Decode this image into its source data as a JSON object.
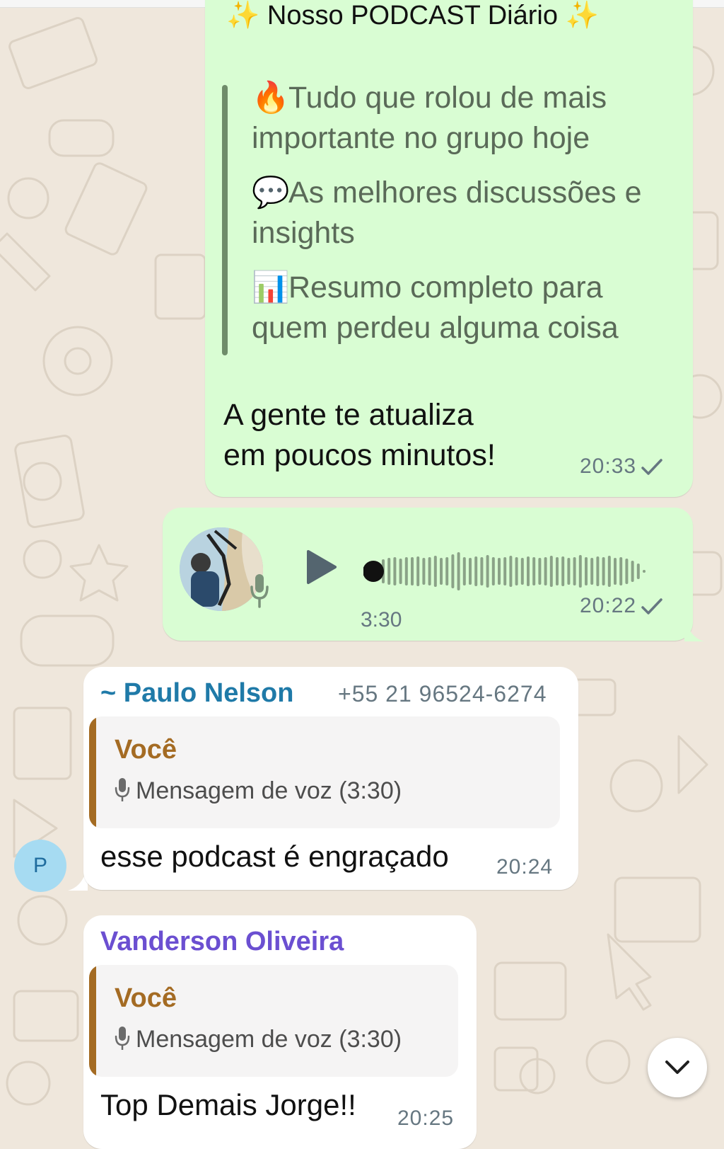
{
  "messages": {
    "podcast": {
      "title_emoji_left": "✨",
      "title": "Nosso PODCAST Diário",
      "title_emoji_right": "✨",
      "quote_items": [
        {
          "emoji": "🔥",
          "line1": "Tudo que rolou de mais",
          "line2": "importante no grupo hoje"
        },
        {
          "emoji": "💬",
          "line1": "As melhores discussões e",
          "line2": "insights"
        },
        {
          "emoji": "📊",
          "line1": "Resumo completo para",
          "line2": "quem perdeu alguma coisa"
        }
      ],
      "body_line1": "A gente te atualiza",
      "body_line2": "em poucos minutos!",
      "time": "20:33"
    },
    "voice": {
      "duration": "3:30",
      "time": "20:22",
      "progress": 0
    },
    "paulo": {
      "sender": "~ Paulo Nelson",
      "phone": "+55 21 96524-6274",
      "reply_author": "Você",
      "reply_content": "Mensagem de voz (3:30)",
      "text": "esse podcast é engraçado",
      "time": "20:24",
      "avatar_letter": "P"
    },
    "vanderson": {
      "sender": "Vanderson Oliveira",
      "reply_author": "Você",
      "reply_content": "Mensagem de voz (3:30)",
      "text": "Top Demais Jorge!!",
      "time": "20:25"
    }
  },
  "colors": {
    "outgoing_bubble": "#d9fdd3",
    "incoming_bubble": "#ffffff",
    "chat_background": "#efe7dc",
    "paulo_name": "#1f7aa8",
    "vanderson_name": "#6b4fd1",
    "reply_accent": "#a46b23",
    "timestamp": "#667781"
  },
  "icons": {
    "play": "play-icon",
    "mic": "microphone-icon",
    "check": "single-check-icon",
    "scroll": "chevron-down-icon"
  }
}
